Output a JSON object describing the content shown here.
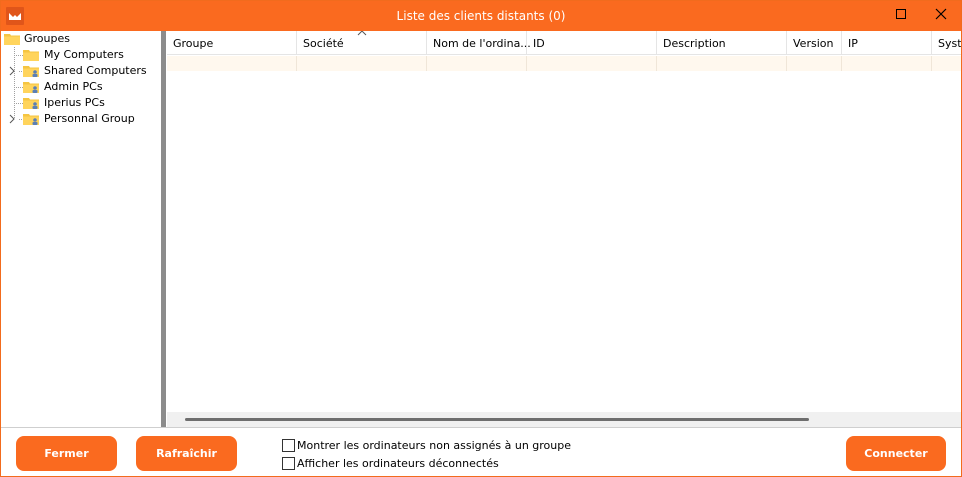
{
  "window": {
    "title": "Liste des clients distants (0)",
    "accent_color": "#fa6a1f"
  },
  "tree": {
    "root": {
      "label": "Groupes",
      "icon": "folder-icon"
    },
    "items": [
      {
        "label": "My Computers",
        "icon": "folder-icon",
        "expandable": false
      },
      {
        "label": "Shared Computers",
        "icon": "user-folder-icon",
        "expandable": true
      },
      {
        "label": "Admin PCs",
        "icon": "user-folder-icon",
        "expandable": false
      },
      {
        "label": "Iperius PCs",
        "icon": "user-folder-icon",
        "expandable": false
      },
      {
        "label": "Personnal Group",
        "icon": "user-folder-icon",
        "expandable": true
      }
    ]
  },
  "grid": {
    "columns": [
      "Groupe",
      "Société",
      "Nom de l'ordina...",
      "ID",
      "Description",
      "Version",
      "IP",
      "Syste"
    ],
    "rows": []
  },
  "buttons": {
    "close": "Fermer",
    "refresh": "Rafraîchir",
    "connect": "Connecter"
  },
  "options": {
    "show_unassigned": {
      "label": "Montrer les ordinateurs non assignés à un groupe",
      "checked": false
    },
    "show_disconnected": {
      "label": "Afficher les ordinateurs déconnectés",
      "checked": false
    }
  }
}
